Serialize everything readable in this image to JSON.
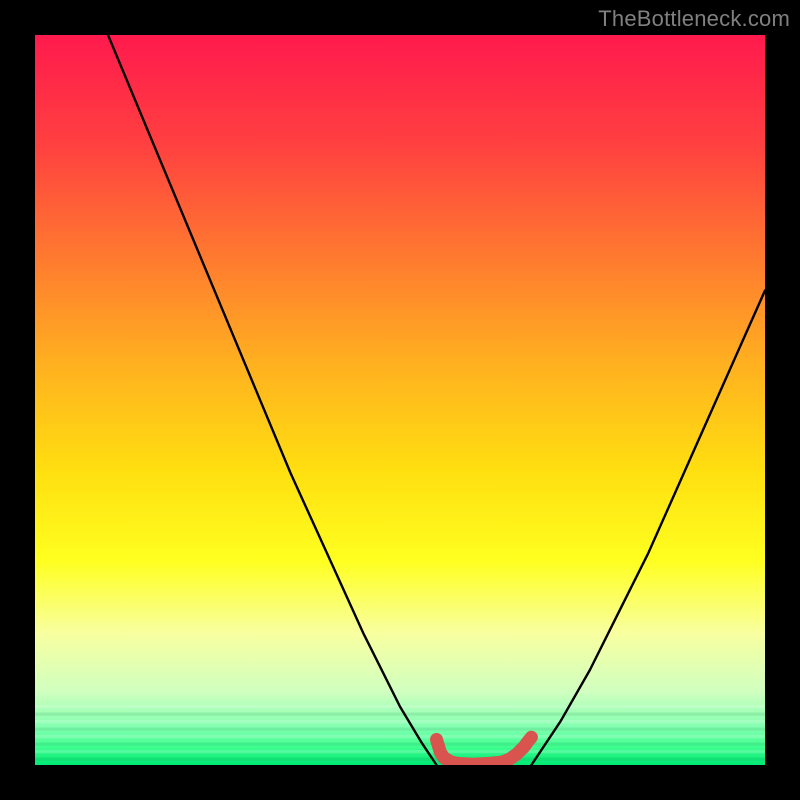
{
  "watermark": "TheBottleneck.com",
  "chart_data": {
    "type": "line",
    "title": "",
    "xlabel": "",
    "ylabel": "",
    "xlim": [
      0,
      100
    ],
    "ylim": [
      0,
      100
    ],
    "series": [
      {
        "name": "black-curve-left",
        "x": [
          10,
          15,
          20,
          25,
          30,
          35,
          40,
          45,
          50,
          53,
          55
        ],
        "y": [
          100,
          88,
          76,
          64,
          52,
          40,
          29,
          18,
          8,
          3,
          0
        ]
      },
      {
        "name": "black-curve-right",
        "x": [
          68,
          72,
          76,
          80,
          84,
          88,
          92,
          96,
          100
        ],
        "y": [
          0,
          6,
          13,
          21,
          29,
          38,
          47,
          56,
          65
        ]
      },
      {
        "name": "red-valley-marker",
        "x": [
          55,
          55.5,
          56,
          57,
          58,
          60,
          62,
          64,
          65,
          66,
          67,
          67.5,
          68
        ],
        "y": [
          3.5,
          1.8,
          1.0,
          0.4,
          0.2,
          0.1,
          0.2,
          0.4,
          0.8,
          1.5,
          2.5,
          3.2,
          3.8
        ]
      }
    ],
    "gradient_stops": [
      {
        "offset": 0.0,
        "color": "#ff1a4d"
      },
      {
        "offset": 0.15,
        "color": "#ff4040"
      },
      {
        "offset": 0.3,
        "color": "#ff7830"
      },
      {
        "offset": 0.45,
        "color": "#ffb020"
      },
      {
        "offset": 0.6,
        "color": "#ffe010"
      },
      {
        "offset": 0.72,
        "color": "#ffff20"
      },
      {
        "offset": 0.82,
        "color": "#f8ffa0"
      },
      {
        "offset": 0.9,
        "color": "#d0ffc0"
      },
      {
        "offset": 0.95,
        "color": "#80ffb0"
      },
      {
        "offset": 0.975,
        "color": "#40ff90"
      },
      {
        "offset": 1.0,
        "color": "#00e874"
      }
    ]
  }
}
